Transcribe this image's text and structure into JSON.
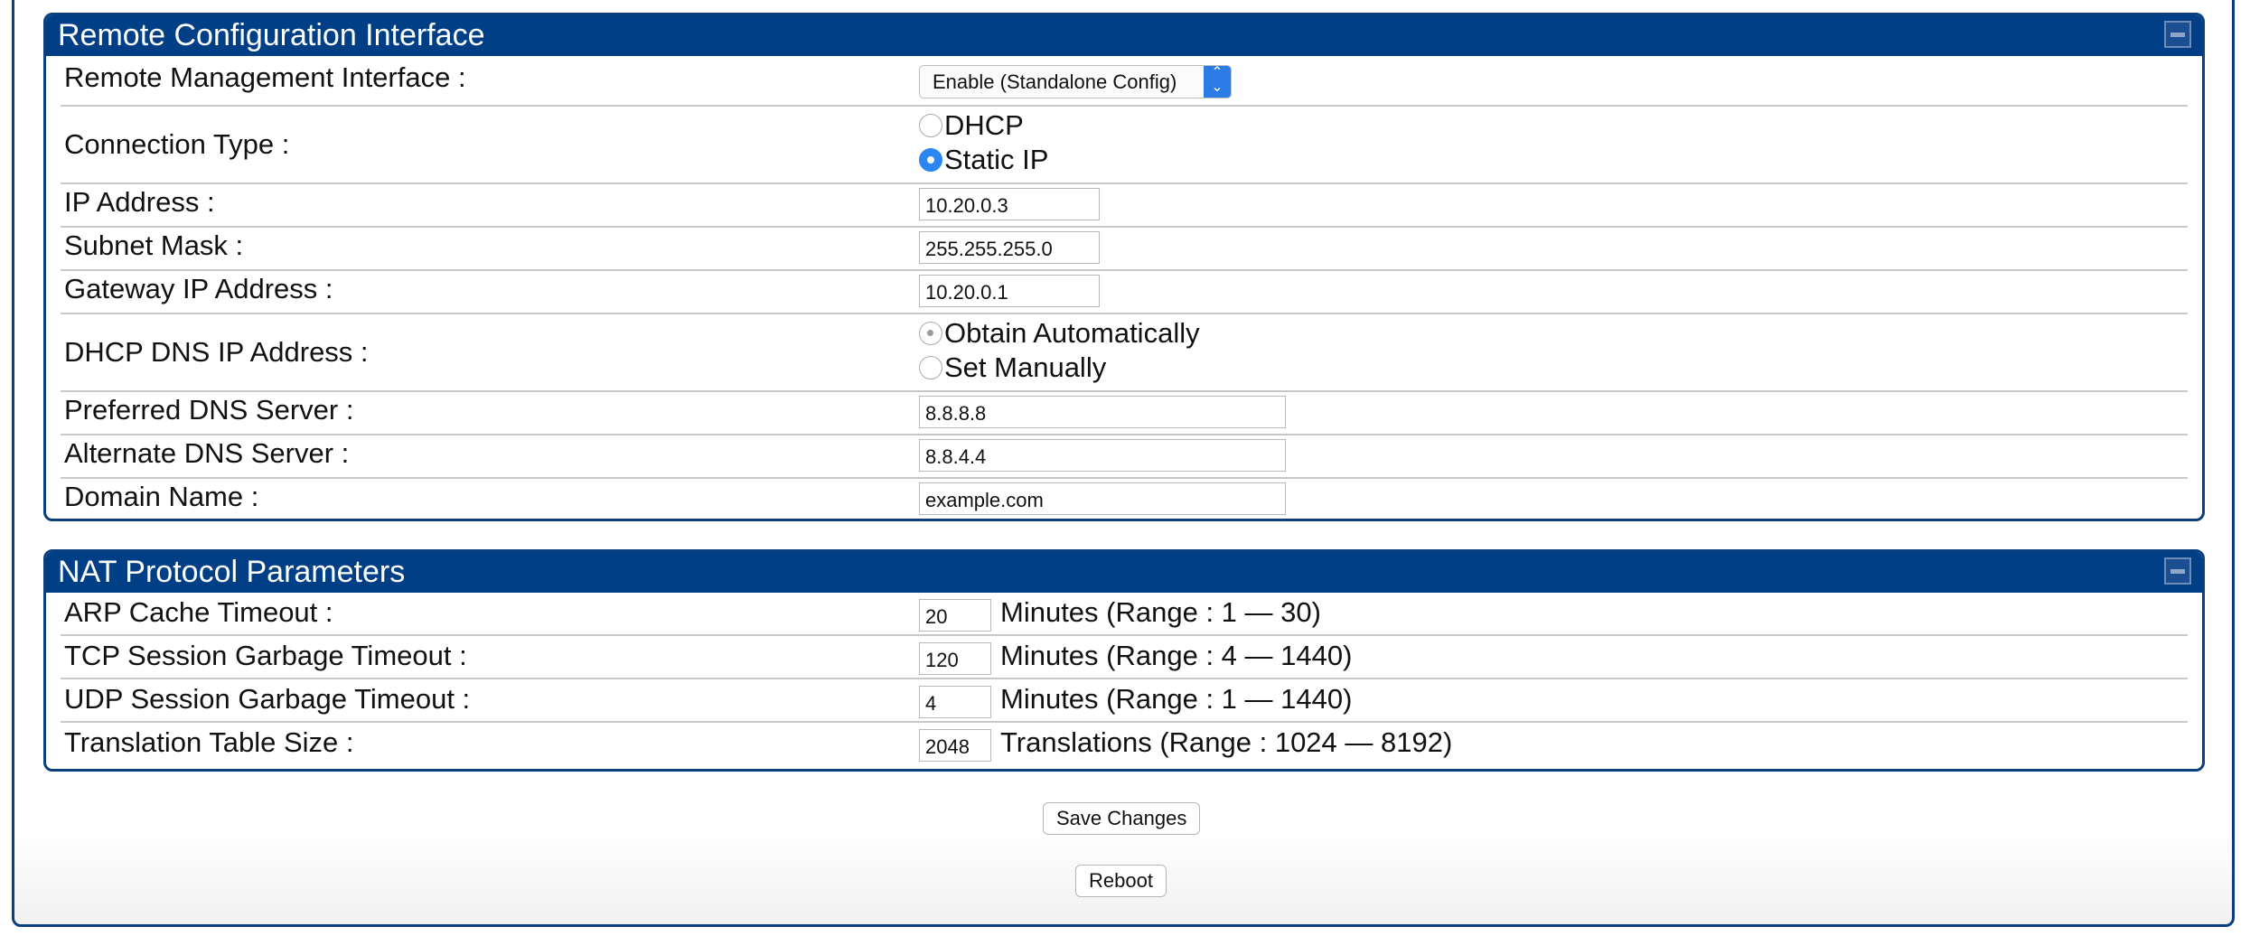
{
  "remote_panel": {
    "title": "Remote Configuration Interface",
    "rows": {
      "rmi_label": "Remote Management Interface :",
      "rmi_value": "Enable (Standalone Config)",
      "conn_label": "Connection Type :",
      "conn_options": [
        "DHCP",
        "Static IP"
      ],
      "conn_selected": "Static IP",
      "ip_label": "IP Address :",
      "ip_value": "10.20.0.3",
      "mask_label": "Subnet Mask :",
      "mask_value": "255.255.255.0",
      "gw_label": "Gateway IP Address :",
      "gw_value": "10.20.0.1",
      "dhcp_dns_label": "DHCP DNS IP Address :",
      "dhcp_dns_options": [
        "Obtain Automatically",
        "Set Manually"
      ],
      "dhcp_dns_selected": "Obtain Automatically",
      "pref_dns_label": "Preferred DNS Server :",
      "pref_dns_value": "8.8.8.8",
      "alt_dns_label": "Alternate DNS Server :",
      "alt_dns_value": "8.8.4.4",
      "domain_label": "Domain Name :",
      "domain_value": "example.com"
    }
  },
  "nat_panel": {
    "title": "NAT Protocol Parameters",
    "rows": {
      "arp_label": "ARP Cache Timeout :",
      "arp_value": "20",
      "arp_unit": "Minutes (Range : 1 — 30)",
      "tcp_label": "TCP Session Garbage Timeout :",
      "tcp_value": "120",
      "tcp_unit": "Minutes (Range : 4 — 1440)",
      "udp_label": "UDP Session Garbage Timeout :",
      "udp_value": "4",
      "udp_unit": "Minutes (Range : 1 — 1440)",
      "tts_label": "Translation Table Size :",
      "tts_value": "2048",
      "tts_unit": "Translations (Range : 1024 — 8192)"
    }
  },
  "actions": {
    "save_label": "Save Changes",
    "reboot_label": "Reboot"
  },
  "colors": {
    "header_bg": "#003f86",
    "border": "#0b3f7d",
    "radio_selected": "#2c86f2"
  }
}
